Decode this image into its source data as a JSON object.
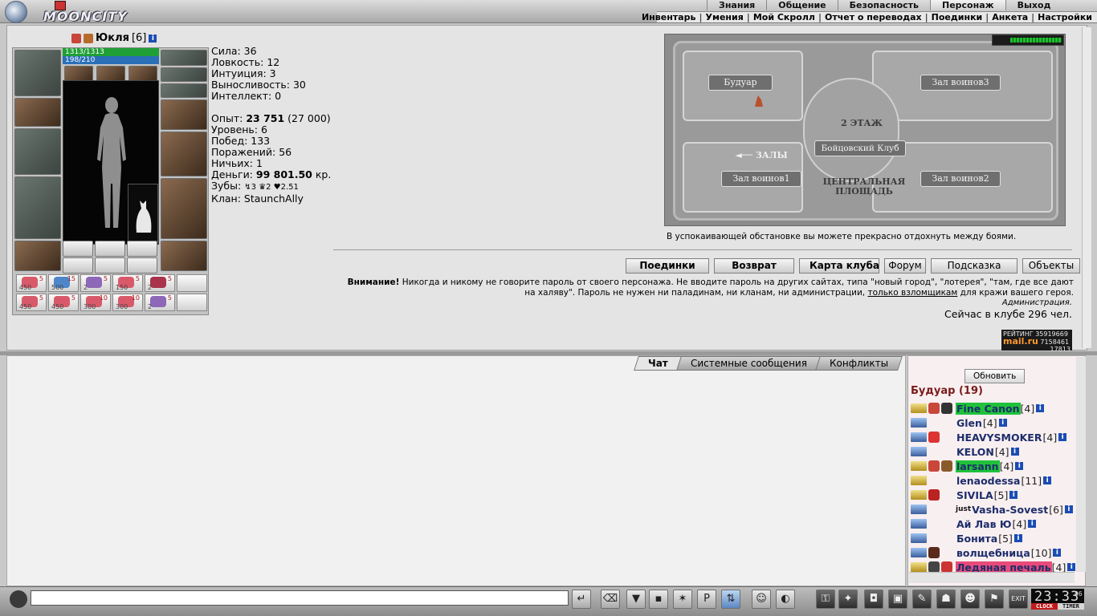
{
  "brand": {
    "name": "MOONCITY"
  },
  "menu": {
    "main": [
      "Знания",
      "Общение",
      "Безопасность",
      "Персонаж",
      "Выход"
    ],
    "selected": "Персонаж",
    "sub": [
      "Инвентарь",
      "Умения",
      "Мой Скролл",
      "Отчет о переводах",
      "Поединки",
      "Анкета",
      "Настройки"
    ]
  },
  "character": {
    "name": "Юкля",
    "level": "[6]",
    "hp": "1313/1313",
    "mana": "198/210",
    "stats": {
      "strength": "Сила: 36",
      "agility": "Ловкость: 12",
      "intuition": "Интуиция: 3",
      "endurance": "Выносливость: 30",
      "intellect": "Интеллект: 0"
    },
    "exp_label": "Опыт: ",
    "exp_value": "23 751",
    "exp_next": " (27 000)",
    "level_line": "Уровень: 6",
    "wins": "Побед: 133",
    "losses": "Поражений: 56",
    "draws": "Ничьих: 1",
    "money_label": "Деньги: ",
    "money_value": "99 801.50",
    "money_unit": " кр.",
    "teeth_label": "Зубы: ",
    "teeth": [
      "3",
      "2",
      "2.51"
    ],
    "clan": "Клан: StaunchAlly",
    "potions": [
      {
        "n1": "5",
        "n2": "450",
        "color": "#d85a6a"
      },
      {
        "n1": "15",
        "n2": "500",
        "color": "#4f86c9"
      },
      {
        "n1": "5",
        "n2": "2",
        "color": "#8e67b8"
      },
      {
        "n1": "5",
        "n2": "150",
        "color": "#d85a6a"
      },
      {
        "n1": "5",
        "n2": "2",
        "color": "#a9334a"
      },
      {
        "n1": "5",
        "n2": "450",
        "color": "#d85a6a"
      },
      {
        "n1": "5",
        "n2": "450",
        "color": "#d85a6a"
      },
      {
        "n1": "10",
        "n2": "300",
        "color": "#d85a6a"
      },
      {
        "n1": "10",
        "n2": "300",
        "color": "#d85a6a"
      },
      {
        "n1": "5",
        "n2": "2",
        "color": "#8e67b8"
      }
    ]
  },
  "map": {
    "rooms": {
      "boudoir": "Будуар",
      "hall3": "Зал воинов3",
      "hall1": "Зал воинов1",
      "hall2": "Зал воинов2"
    },
    "floor": "2 ЭТАЖ",
    "club": "Бойцовский Клуб",
    "halls": "◄── ЗАЛЫ",
    "square": "ЦЕНТРАЛЬНАЯ ПЛОЩАДЬ",
    "caption": "В успокаивающей обстановке вы можете прекрасно отдохнуть между боями."
  },
  "buttons": {
    "fights": "Поединки",
    "back": "Возврат",
    "club_map": "Карта клуба",
    "forum": "Форум",
    "hint": "Подсказка",
    "objects": "Объекты"
  },
  "warning": {
    "bold": "Внимание!",
    "text": " Никогда и никому не говорите пароль от своего персонажа. Не вводите пароль на других сайтах, типа \"новый город\", \"лотерея\", \"там, где все дают на халяву\". Пароль не нужен ни паладинам, ни кланам, ни администрации, ",
    "link": "только взломщикам",
    "tail": " для кражи вашего героя.",
    "admin": "Администрация."
  },
  "online": "Сейчас в клубе 296 чел.",
  "rating": {
    "label": "РЕЙТИНГ",
    "v1": "35919669",
    "v2": "7158461",
    "v3": "17813",
    "mail": "mail.ru"
  },
  "chat": {
    "tabs": [
      "Чат",
      "Системные сообщения",
      "Конфликты"
    ],
    "active": "Чат",
    "input_value": ""
  },
  "users": {
    "refresh": "Обновить",
    "room": "Будуар (19)",
    "list": [
      {
        "name": "Fine Canon",
        "level": "[4]",
        "hl": "#1fc23a",
        "pm": "y",
        "icons": [
          "#c8463a",
          "#333"
        ]
      },
      {
        "name": "Glen",
        "level": "[4]",
        "hl": "",
        "pm": "b",
        "icons": []
      },
      {
        "name": "HEAVYSMOKER",
        "level": "[4]",
        "hl": "",
        "pm": "b",
        "icons": [
          "#d33"
        ]
      },
      {
        "name": "KELON",
        "level": "[4]",
        "hl": "",
        "pm": "b",
        "icons": []
      },
      {
        "name": "larsann",
        "level": "[4]",
        "hl": "#1fc23a",
        "pm": "y",
        "icons": [
          "#c8463a",
          "#8b5a2b"
        ]
      },
      {
        "name": "lenaodessa",
        "level": "[11]",
        "hl": "",
        "pm": "y",
        "icons": []
      },
      {
        "name": "SIVILA",
        "level": "[5]",
        "hl": "",
        "pm": "y",
        "icons": [
          "#b22"
        ]
      },
      {
        "name": "Vasha-Sovest",
        "level": "[6]",
        "hl": "",
        "pm": "b",
        "icons": [],
        "prefix": "just"
      },
      {
        "name": "Ай Лав Ю",
        "level": "[4]",
        "hl": "",
        "pm": "b",
        "icons": []
      },
      {
        "name": "Бонита",
        "level": "[5]",
        "hl": "",
        "pm": "b",
        "icons": []
      },
      {
        "name": "волщебница",
        "level": "[10]",
        "hl": "",
        "pm": "b",
        "icons": [
          "#5a2a1a"
        ]
      },
      {
        "name": "Ледяная печаль",
        "level": "[4]",
        "hl": "#e84a7a",
        "pm": "y",
        "icons": [
          "#444",
          "#c33"
        ]
      }
    ]
  },
  "clock": {
    "time": "23:33",
    "sec": "06",
    "clock_label": "CLOCK",
    "timer_label": "TIMER"
  },
  "colors": {
    "hp": "#1f9f36",
    "mana": "#2a6fb8",
    "accent": "#7a1a1a",
    "nick": "#1d2d6b"
  }
}
